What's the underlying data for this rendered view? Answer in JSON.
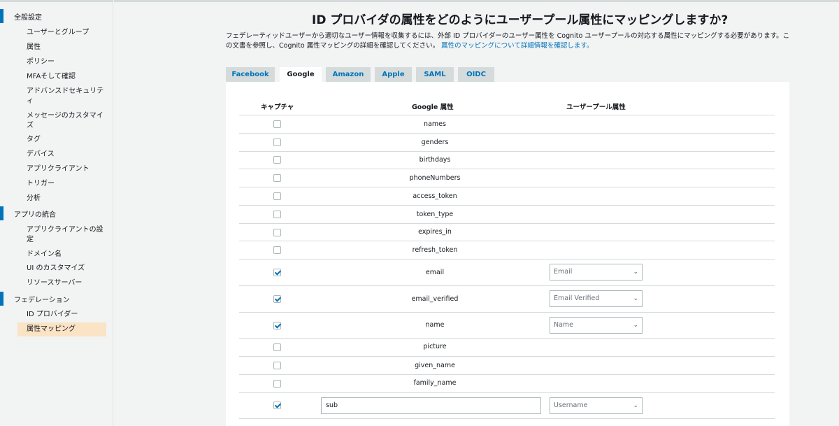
{
  "sidebar": {
    "sections": [
      {
        "label": "全般設定",
        "items": [
          "ユーザーとグループ",
          "属性",
          "ポリシー",
          "MFAそして確認",
          "アドバンスドセキュリティ",
          "メッセージのカスタマイズ",
          "タグ",
          "デバイス",
          "アプリクライアント",
          "トリガー",
          "分析"
        ]
      },
      {
        "label": "アプリの統合",
        "items": [
          "アプリクライアントの設定",
          "ドメイン名",
          "UI のカスタマイズ",
          "リソースサーバー"
        ]
      },
      {
        "label": "フェデレーション",
        "items": [
          "ID プロバイダー",
          "属性マッピング"
        ]
      }
    ],
    "selected": "属性マッピング"
  },
  "page": {
    "title": "ID プロバイダの属性をどのようにユーザープール属性にマッピングしますか?",
    "description": "フェデレーティッドユーザーから適切なユーザー情報を収集するには、外部 ID プロバイダーのユーザー属性を Cognito ユーザープールの対応する属性にマッピングする必要があります。この文書を参照し、Cognito 属性マッピングの詳細を確認してください。",
    "link": "属性のマッピングについて詳細情報を確認します。"
  },
  "tabs": [
    "Facebook",
    "Google",
    "Amazon",
    "Apple",
    "SAML",
    "OIDC"
  ],
  "active_tab": "Google",
  "table": {
    "headers": {
      "capture": "キャプチャ",
      "provider_attr": "Google 属性",
      "pool_attr": "ユーザープール属性"
    },
    "rows": [
      {
        "attr": "names",
        "checked": false
      },
      {
        "attr": "genders",
        "checked": false
      },
      {
        "attr": "birthdays",
        "checked": false
      },
      {
        "attr": "phoneNumbers",
        "checked": false
      },
      {
        "attr": "access_token",
        "checked": false
      },
      {
        "attr": "token_type",
        "checked": false
      },
      {
        "attr": "expires_in",
        "checked": false
      },
      {
        "attr": "refresh_token",
        "checked": false
      },
      {
        "attr": "email",
        "checked": true,
        "mapping": "Email"
      },
      {
        "attr": "email_verified",
        "checked": true,
        "mapping": "Email Verified"
      },
      {
        "attr": "name",
        "checked": true,
        "mapping": "Name"
      },
      {
        "attr": "picture",
        "checked": false
      },
      {
        "attr": "given_name",
        "checked": false
      },
      {
        "attr": "family_name",
        "checked": false
      },
      {
        "attr": "sub",
        "checked": true,
        "mapping": "Username",
        "editable": true
      }
    ]
  },
  "icons": {
    "chevron": "chevron-down-icon",
    "check": "checkmark-icon"
  },
  "colors": {
    "accent": "#0073bb",
    "selected_bg": "#fbe3c6"
  }
}
